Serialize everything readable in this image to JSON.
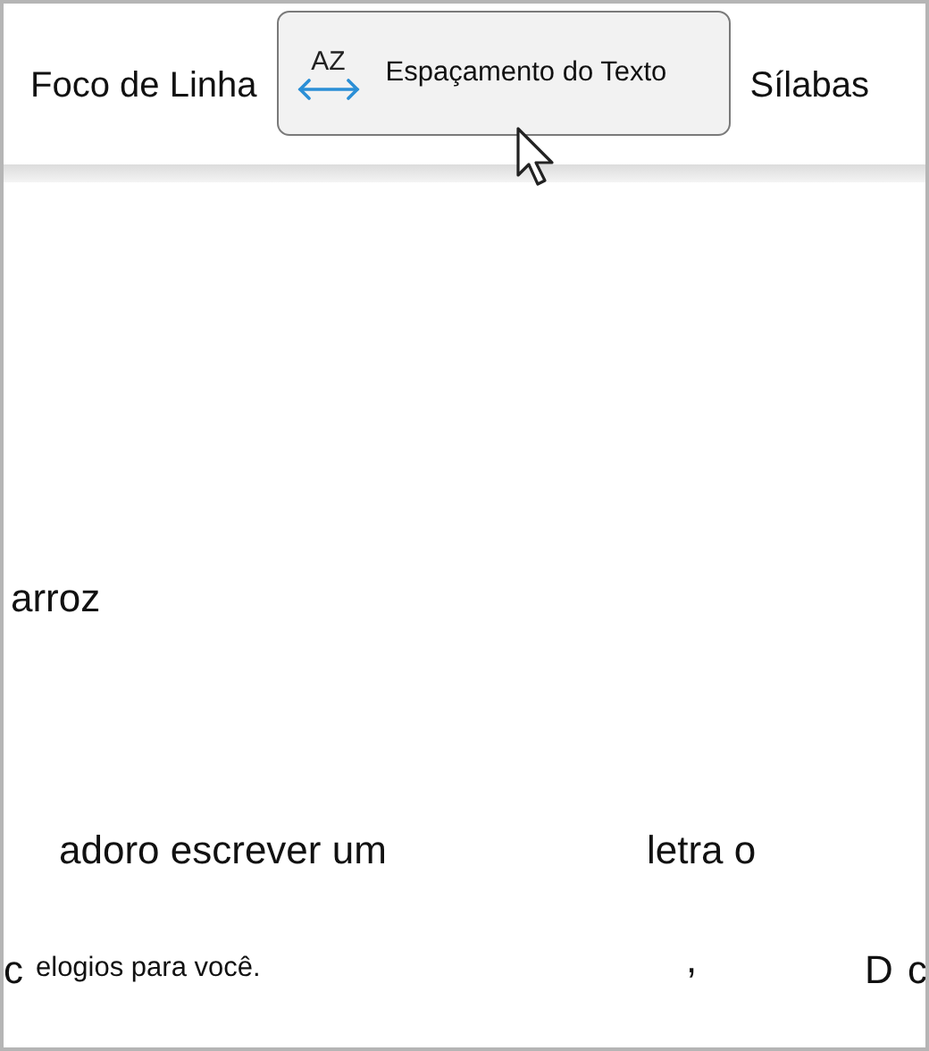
{
  "toolbar": [
    {
      "label": "Foco de Linha",
      "kind": "text",
      "selected": false
    },
    {
      "label": "Espaçamento do Texto",
      "kind": "spacing",
      "icon_text": "AZ",
      "selected": true
    },
    {
      "label": "Sílabas",
      "kind": "text",
      "selected": false
    }
  ],
  "document": [
    {
      "text": "arroz",
      "kind": "large"
    },
    {
      "text": "adoro escrever um",
      "kind": "large"
    },
    {
      "text": "letra o",
      "kind": "large"
    },
    {
      "text": "c",
      "kind": "large"
    },
    {
      "text": "elogios para você.",
      "kind": "small"
    },
    {
      "text": ",",
      "kind": "large"
    },
    {
      "text": "D",
      "kind": "large"
    },
    {
      "text": "c",
      "kind": "large"
    }
  ]
}
